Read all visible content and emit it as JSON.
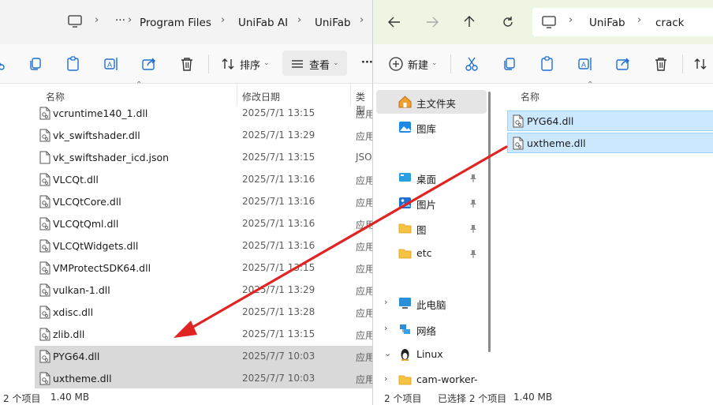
{
  "left_window": {
    "breadcrumbs": [
      "Program Files",
      "UniFab AI",
      "UniFab"
    ],
    "more_label": "···",
    "toolbar": {
      "sort_label": "排序",
      "view_label": "查看",
      "overflow_label": "···"
    },
    "columns": {
      "name": "名称",
      "date": "修改日期",
      "type": "类型"
    },
    "files": [
      {
        "name": "vcruntime140_1.dll",
        "date": "2025/7/1 13:15",
        "type": "应用",
        "icon": "dll-file-icon"
      },
      {
        "name": "vk_swiftshader.dll",
        "date": "2025/7/1 13:29",
        "type": "应用",
        "icon": "dll-file-icon"
      },
      {
        "name": "vk_swiftshader_icd.json",
        "date": "2025/7/1 13:15",
        "type": "JSO",
        "icon": "blank-file-icon"
      },
      {
        "name": "VLCQt.dll",
        "date": "2025/7/1 13:16",
        "type": "应用",
        "icon": "dll-file-icon"
      },
      {
        "name": "VLCQtCore.dll",
        "date": "2025/7/1 13:16",
        "type": "应用",
        "icon": "dll-file-icon"
      },
      {
        "name": "VLCQtQml.dll",
        "date": "2025/7/1 13:16",
        "type": "应用",
        "icon": "dll-file-icon"
      },
      {
        "name": "VLCQtWidgets.dll",
        "date": "2025/7/1 13:16",
        "type": "应用",
        "icon": "dll-file-icon"
      },
      {
        "name": "VMProtectSDK64.dll",
        "date": "2025/7/1 13:15",
        "type": "应用",
        "icon": "dll-file-icon"
      },
      {
        "name": "vulkan-1.dll",
        "date": "2025/7/1 13:29",
        "type": "应用",
        "icon": "dll-file-icon"
      },
      {
        "name": "xdisc.dll",
        "date": "2025/7/1 13:28",
        "type": "应用",
        "icon": "dll-file-icon"
      },
      {
        "name": "zlib.dll",
        "date": "2025/7/1 13:15",
        "type": "应用",
        "icon": "dll-file-icon"
      },
      {
        "name": "PYG64.dll",
        "date": "2025/7/7 10:03",
        "type": "应用",
        "icon": "dll-file-icon",
        "selected": true
      },
      {
        "name": "uxtheme.dll",
        "date": "2025/7/7 10:03",
        "type": "应用",
        "icon": "dll-file-icon",
        "selected": true
      }
    ],
    "status": {
      "count": "2 个项目",
      "size": "1.40 MB"
    }
  },
  "right_window": {
    "breadcrumbs": [
      "UniFab",
      "crack"
    ],
    "toolbar": {
      "new_label": "新建"
    },
    "nav": [
      {
        "label": "主文件夹",
        "icon": "home-icon",
        "selected": true
      },
      {
        "label": "图库",
        "icon": "gallery-icon"
      },
      {
        "label": "桌面",
        "icon": "desktop-icon",
        "pinned": true
      },
      {
        "label": "图片",
        "icon": "pictures-icon",
        "pinned": true
      },
      {
        "label": "图",
        "icon": "folder-icon",
        "pinned": true
      },
      {
        "label": "etc",
        "icon": "folder-icon",
        "pinned": true
      },
      {
        "label": "此电脑",
        "icon": "this-pc-icon",
        "expandable": true
      },
      {
        "label": "网络",
        "icon": "network-icon",
        "expandable": true
      },
      {
        "label": "Linux",
        "icon": "linux-icon",
        "expanded": true
      },
      {
        "label": "cam-worker-",
        "icon": "folder-icon",
        "expandable": true
      }
    ],
    "columns": {
      "name": "名称"
    },
    "files": [
      {
        "name": "PYG64.dll",
        "icon": "dll-file-icon",
        "selected": true
      },
      {
        "name": "uxtheme.dll",
        "icon": "dll-file-icon",
        "selected": true
      }
    ],
    "status": {
      "count": "2 个项目",
      "selected": "已选择 2 个项目",
      "size": "1.40 MB"
    }
  },
  "colors": {
    "selection_blue": "#cce8ff",
    "selection_gray": "#d9d9d9",
    "arrow_red": "#e02424",
    "right_header_tint": "#eef5e2"
  }
}
